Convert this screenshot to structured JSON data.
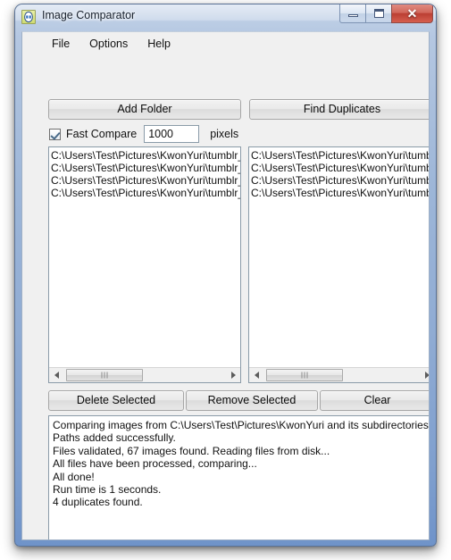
{
  "window": {
    "title": "Image Comparator",
    "icon": "app-icon",
    "controls": {
      "minimize": "minimize-button",
      "maximize": "maximize-button",
      "close_glyph": "✕"
    },
    "colors": {
      "frame": "#8fabd3",
      "client": "#f0f0f0",
      "close_red": "#bb3f33",
      "field_border": "#8a9ba8"
    }
  },
  "menu": {
    "items": [
      {
        "label": "File"
      },
      {
        "label": "Options"
      },
      {
        "label": "Help"
      }
    ]
  },
  "toolbar": {
    "add_folder_label": "Add Folder",
    "find_duplicates_label": "Find Duplicates"
  },
  "fast_compare": {
    "checked": true,
    "label": "Fast Compare",
    "pixels_value": "1000",
    "pixels_placeholder": "1000",
    "suffix_label": "pixels"
  },
  "lists": {
    "left": {
      "name": "left-results-list",
      "rows": [
        "C:\\Users\\Test\\Pictures\\KwonYuri\\tumblr_m",
        "C:\\Users\\Test\\Pictures\\KwonYuri\\tumblr_m",
        "C:\\Users\\Test\\Pictures\\KwonYuri\\tumblr_m",
        "C:\\Users\\Test\\Pictures\\KwonYuri\\tumblr_m"
      ]
    },
    "right": {
      "name": "right-results-list",
      "rows": [
        "C:\\Users\\Test\\Pictures\\KwonYuri\\tumblr_m",
        "C:\\Users\\Test\\Pictures\\KwonYuri\\tumblr_m",
        "C:\\Users\\Test\\Pictures\\KwonYuri\\tumblr_m",
        "C:\\Users\\Test\\Pictures\\KwonYuri\\tumblr_m"
      ]
    }
  },
  "actions": {
    "delete_selected_label": "Delete Selected",
    "remove_selected_label": "Remove Selected",
    "clear_label": "Clear"
  },
  "log": {
    "lines": [
      "Comparing images from C:\\Users\\Test\\Pictures\\KwonYuri and its subdirectories.",
      "Paths added successfully.",
      "Files validated, 67 images found. Reading files from disk...",
      "All files have been processed, comparing...",
      "All done!",
      "Run time is 1 seconds.",
      "4 duplicates found."
    ]
  }
}
